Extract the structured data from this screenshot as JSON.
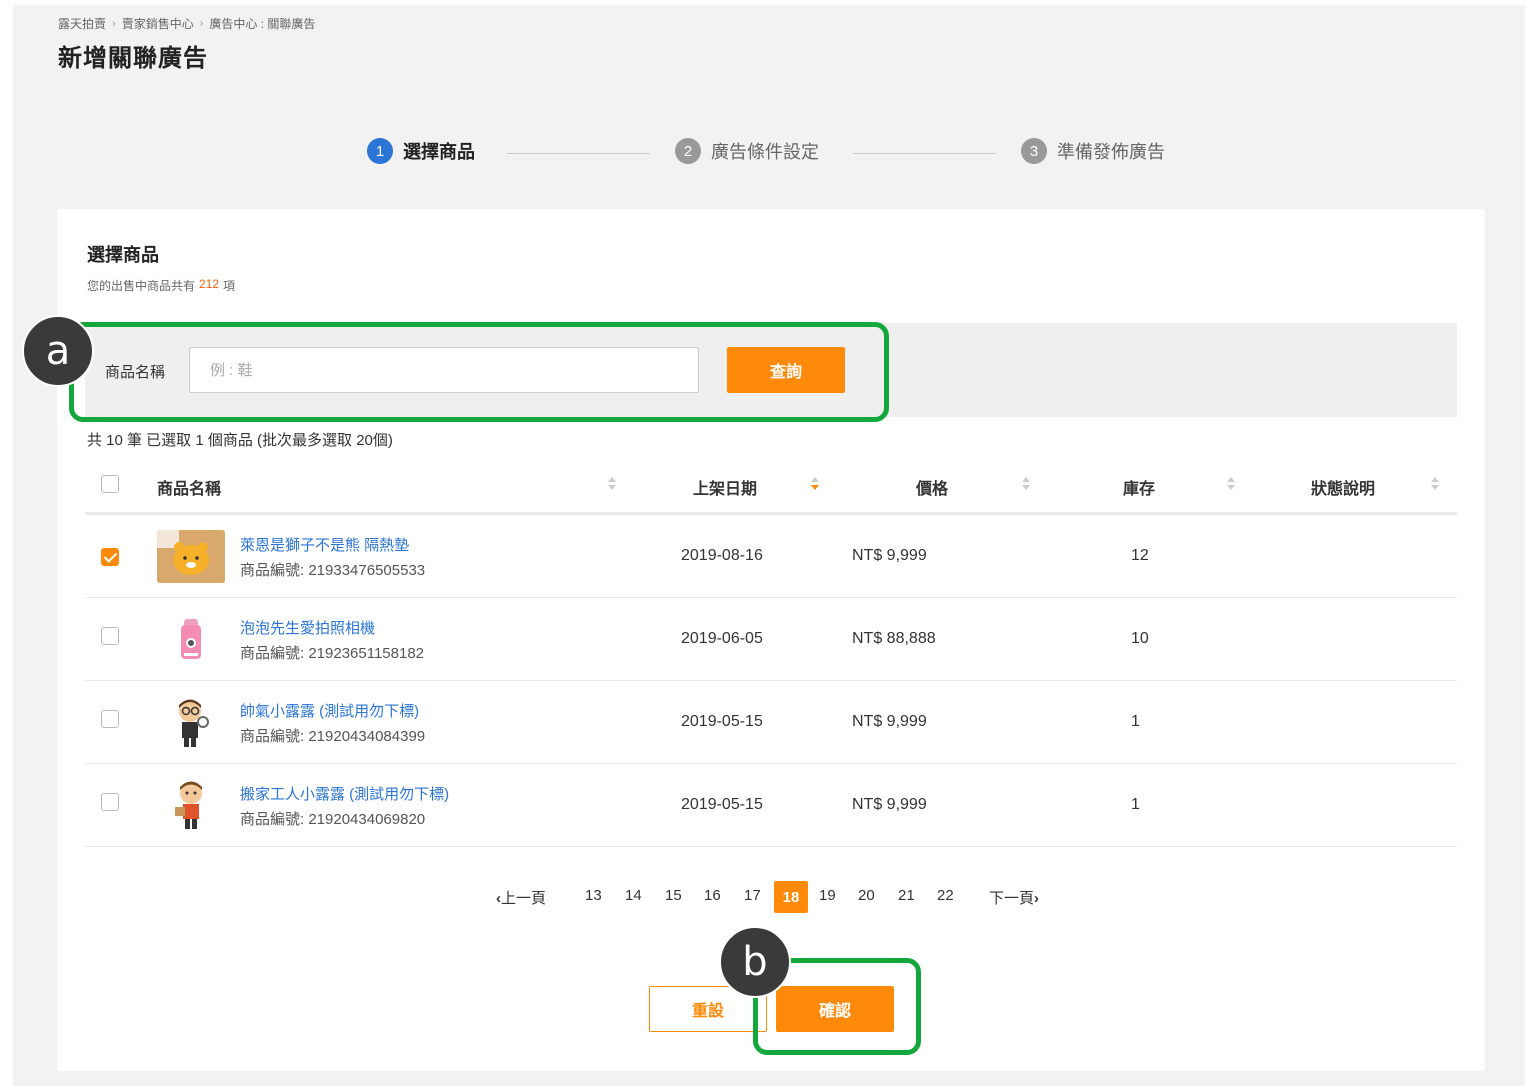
{
  "breadcrumb": [
    "露天拍賣",
    "賣家銷售中心",
    "廣告中心 : 關聯廣告"
  ],
  "page_title": "新增關聯廣告",
  "steps": [
    {
      "num": "1",
      "label": "選擇商品",
      "active": true
    },
    {
      "num": "2",
      "label": "廣告條件設定",
      "active": false
    },
    {
      "num": "3",
      "label": "準備發佈廣告",
      "active": false
    }
  ],
  "section": {
    "title": "選擇商品",
    "sub_prefix": "您的出售中商品共有",
    "sub_count": "212",
    "sub_suffix": "項"
  },
  "search": {
    "label": "商品名稱",
    "placeholder": "例 : 鞋",
    "value": "",
    "button": "查詢"
  },
  "summary": "共 10 筆 已選取 1 個商品 (批次最多選取 20個)",
  "table": {
    "headers": [
      "商品名稱",
      "上架日期",
      "價格",
      "庫存",
      "狀態說明"
    ],
    "rows": [
      {
        "checked": true,
        "name": "萊恩是獅子不是熊 隔熱墊",
        "id": "商品編號: 21933476505533",
        "date": "2019-08-16",
        "price": "NT$ 9,999",
        "stock": "12",
        "status": ""
      },
      {
        "checked": false,
        "name": "泡泡先生愛拍照相機",
        "id": "商品編號: 21923651158182",
        "date": "2019-06-05",
        "price": "NT$ 88,888",
        "stock": "10",
        "status": ""
      },
      {
        "checked": false,
        "name": "帥氣小露露 (測試用勿下標)",
        "id": "商品編號: 21920434084399",
        "date": "2019-05-15",
        "price": "NT$ 9,999",
        "stock": "1",
        "status": ""
      },
      {
        "checked": false,
        "name": "搬家工人小露露 (測試用勿下標)",
        "id": "商品編號: 21920434069820",
        "date": "2019-05-15",
        "price": "NT$ 9,999",
        "stock": "1",
        "status": ""
      }
    ]
  },
  "pagination": {
    "prev": "上一頁",
    "pages": [
      "13",
      "14",
      "15",
      "16",
      "17",
      "18",
      "19",
      "20",
      "21",
      "22"
    ],
    "current": "18",
    "next": "下一頁"
  },
  "actions": {
    "reset": "重設",
    "confirm": "確認"
  },
  "annotations": {
    "a": "a",
    "b": "b"
  },
  "colors": {
    "accent": "#ff8a0a",
    "link": "#2b74d8",
    "highlight": "#14a83c"
  }
}
